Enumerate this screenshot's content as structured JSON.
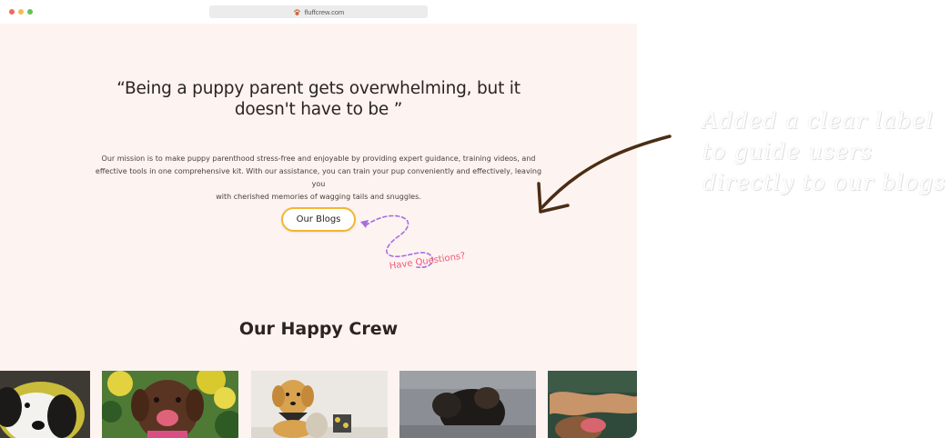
{
  "browser": {
    "url": "fluffcrew.com",
    "url_icon": "paw-favicon-icon"
  },
  "hero": {
    "quote_line1": "“Being a puppy parent gets overwhelming, but it",
    "quote_line2": "doesn't have to be ”",
    "mission_line1": "Our mission is to make puppy parenthood stress-free and enjoyable by providing expert guidance, training videos, and",
    "mission_line2": "effective tools in one comprehensive kit. With our assistance, you can train your pup conveniently and effectively, leaving you",
    "mission_line3": "with cherished memories of wagging tails and snuggles.",
    "blogs_button": "Our Blogs",
    "have_questions": "Have Questions?"
  },
  "crew": {
    "title": "Our Happy Crew",
    "photos": [
      {
        "name": "black-white-dog-in-yellow-hood"
      },
      {
        "name": "brown-labrador-with-yellow-flowers"
      },
      {
        "name": "golden-retriever-puppy-with-bandana"
      },
      {
        "name": "black-dog-on-pavement"
      },
      {
        "name": "dog-with-antler-toy"
      }
    ]
  },
  "annotation": {
    "line1": "Added a clear label",
    "line2": "to guide users",
    "line3": "directly to our blogs",
    "arrow_color": "#4a2d14"
  },
  "colors": {
    "page_bg": "#fdf3f1",
    "button_border": "#f2b632",
    "accent_pink": "#ee5a79",
    "squiggle_purple": "#a56fe0"
  }
}
